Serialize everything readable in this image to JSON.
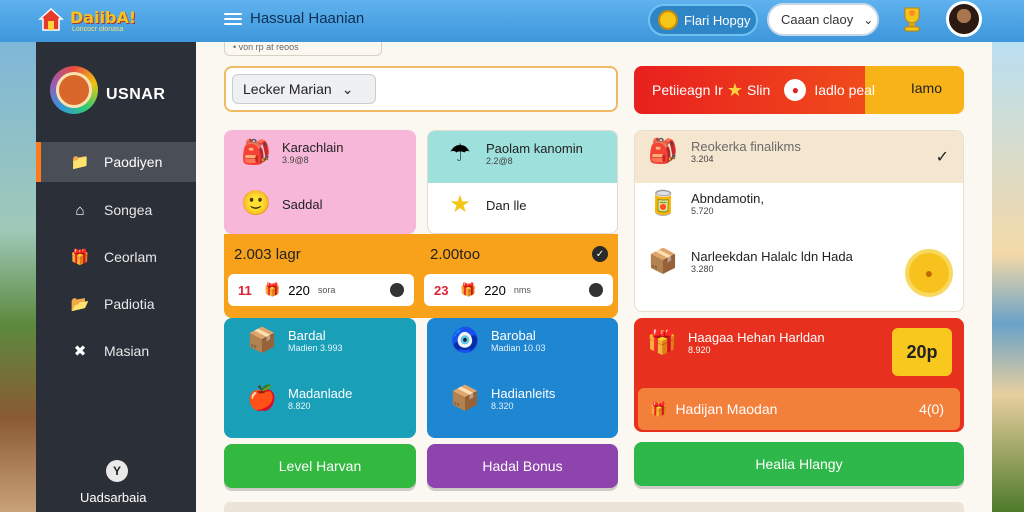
{
  "header": {
    "logo_text": "DaiibA!",
    "logo_sub": "Loncocr olonasa",
    "title": "Hassual Haanian",
    "currency_label": "Flari Hopgy",
    "dropdown_label": "Caaan claoy"
  },
  "sidebar": {
    "profile_name": "USNAR",
    "items": [
      {
        "label": "Paodiyen",
        "icon": "folder-icon",
        "active": true
      },
      {
        "label": "Songea",
        "icon": "home-icon",
        "active": false
      },
      {
        "label": "Ceorlam",
        "icon": "gift-icon",
        "active": false
      },
      {
        "label": "Padiotia",
        "icon": "folder-icon",
        "active": false
      },
      {
        "label": "Masian",
        "icon": "tools-icon",
        "active": false
      }
    ],
    "bottom_label": "Uadsarbaia"
  },
  "main": {
    "breadcrumb": "• von rp at reoos",
    "filter_label": "Lecker Marian",
    "pink_card": {
      "row1_title": "Karachlain",
      "row1_sub": "3.9@8",
      "row2_title": "Saddal"
    },
    "teal_card": {
      "row1_title": "Paolam kanomin",
      "row1_sub": "2.2@8",
      "row2_title": "Dan lle"
    },
    "orange_band": {
      "left_label": "2.003 lagr",
      "right_label": "2.00too",
      "left_mini": {
        "num": "11",
        "value": "220",
        "unit": "sora"
      },
      "right_mini": {
        "num": "23",
        "value": "220",
        "unit": "nms"
      }
    },
    "teal_big": {
      "row1_title": "Bardal",
      "row1_sub": "Madien 3.993",
      "row2_title": "Madanlade",
      "row2_sub": "8.820"
    },
    "blue_big": {
      "row1_title": "Barobal",
      "row1_sub": "Madian 10.03",
      "row2_title": "Hadianleits",
      "row2_sub": "8.320"
    },
    "buttons": {
      "level": "Level Harvan",
      "bonus": "Hadal Bonus",
      "green_right": "Healia Hlangy"
    }
  },
  "right": {
    "banner_left": "Petiieagn Ir",
    "banner_mid": "Slin",
    "banner_tag": "Iadlo peal",
    "banner_right": "Iamo",
    "list": [
      {
        "title": "Reokerka finalikms",
        "sub": "3.204"
      },
      {
        "title": "Abndamotin,",
        "sub": "5.720"
      },
      {
        "title": "Narleekdan Halalc ldn Hada",
        "sub": "3.280"
      }
    ],
    "offer": {
      "title": "Haagaa Hehan Harldan",
      "sub": "8.920",
      "price": "20p",
      "bottom_label": "Hadijan Maodan",
      "bottom_right": "4(0)"
    }
  },
  "colors": {
    "topbar": "#3d97db",
    "sidebar": "#2b3038",
    "accent_orange": "#f7a21a",
    "pink": "#f7b7d8",
    "teal": "#9ee0dc",
    "teal_big": "#1a9fb8",
    "blue_big": "#1f86d1",
    "green": "#33b840",
    "purple": "#8e44ad",
    "red": "#e8301e"
  }
}
